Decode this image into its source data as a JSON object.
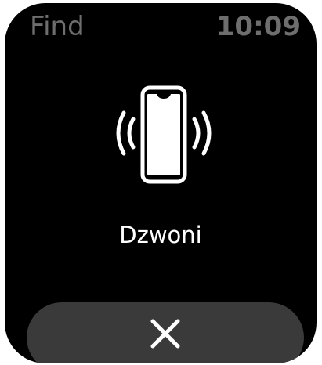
{
  "header": {
    "app_title": "Find",
    "time": "10:09"
  },
  "main": {
    "icon": "ringing-phone-icon",
    "status_label": "Dzwoni"
  },
  "footer": {
    "cancel_icon": "close-icon"
  },
  "colors": {
    "background": "#000000",
    "dim_text": "#6e6e6e",
    "primary_text": "#ffffff",
    "button_bg": "#3a3a3a"
  }
}
